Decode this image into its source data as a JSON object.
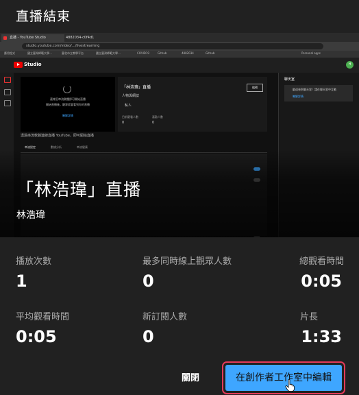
{
  "dialog": {
    "title": "直播結束",
    "stream_title": "「林浩瑋」直播",
    "channel_name": "林浩瑋"
  },
  "preview": {
    "tabs": [
      "直播 - YouTube Studio",
      "4882034-c0f4d1"
    ],
    "url": "studio.youtube.com/video/…/livestreaming",
    "bookmarks": [
      "應用程式",
      "國立臺灣師範大學…",
      "臺北市立教學平台",
      "國立臺灣師範大學…",
      "COVID19",
      "Github",
      "4882034",
      "Github",
      "Personal apps"
    ],
    "studio_label": "Studio",
    "avatar_letter": "H",
    "stream_text_1": "連線至串流軟體即可開始直播",
    "stream_text_2": "開始直播後，觀眾就會看到你的直播",
    "stream_link": "瞭解詳情",
    "info_title": "「林浩瑋」直播",
    "info_category": "人物與網誌",
    "info_privacy": "私人",
    "info_viewers_label": "目前觀看人數",
    "info_viewers": "0",
    "info_likes_label": "喜歡人數",
    "info_likes": "0",
    "edit_label": "編輯",
    "warning": "透過串流軟體連線直播 YouTube，即可開始直播",
    "sub_tabs": [
      "串流設定",
      "數據分析",
      "串流健康"
    ],
    "chat_title": "聊天室",
    "chat_notice": "歡迎來到聊天室！請在聊天室中互動",
    "chat_link": "瞭解詳情"
  },
  "stats": {
    "views_label": "播放次數",
    "views_value": "1",
    "peak_label": "最多同時線上觀眾人數",
    "peak_value": "0",
    "watch_time_label": "總觀看時間",
    "watch_time_value": "0:05",
    "avg_label": "平均觀看時間",
    "avg_value": "0:05",
    "subs_label": "新訂閱人數",
    "subs_value": "0",
    "length_label": "片長",
    "length_value": "1:33"
  },
  "buttons": {
    "close": "關閉",
    "edit": "在創作者工作室中編輯"
  },
  "colors": {
    "background": "#212121",
    "accent": "#3ea6ff",
    "highlight_outline": "#e53a5a",
    "youtube_red": "#ee0000"
  }
}
